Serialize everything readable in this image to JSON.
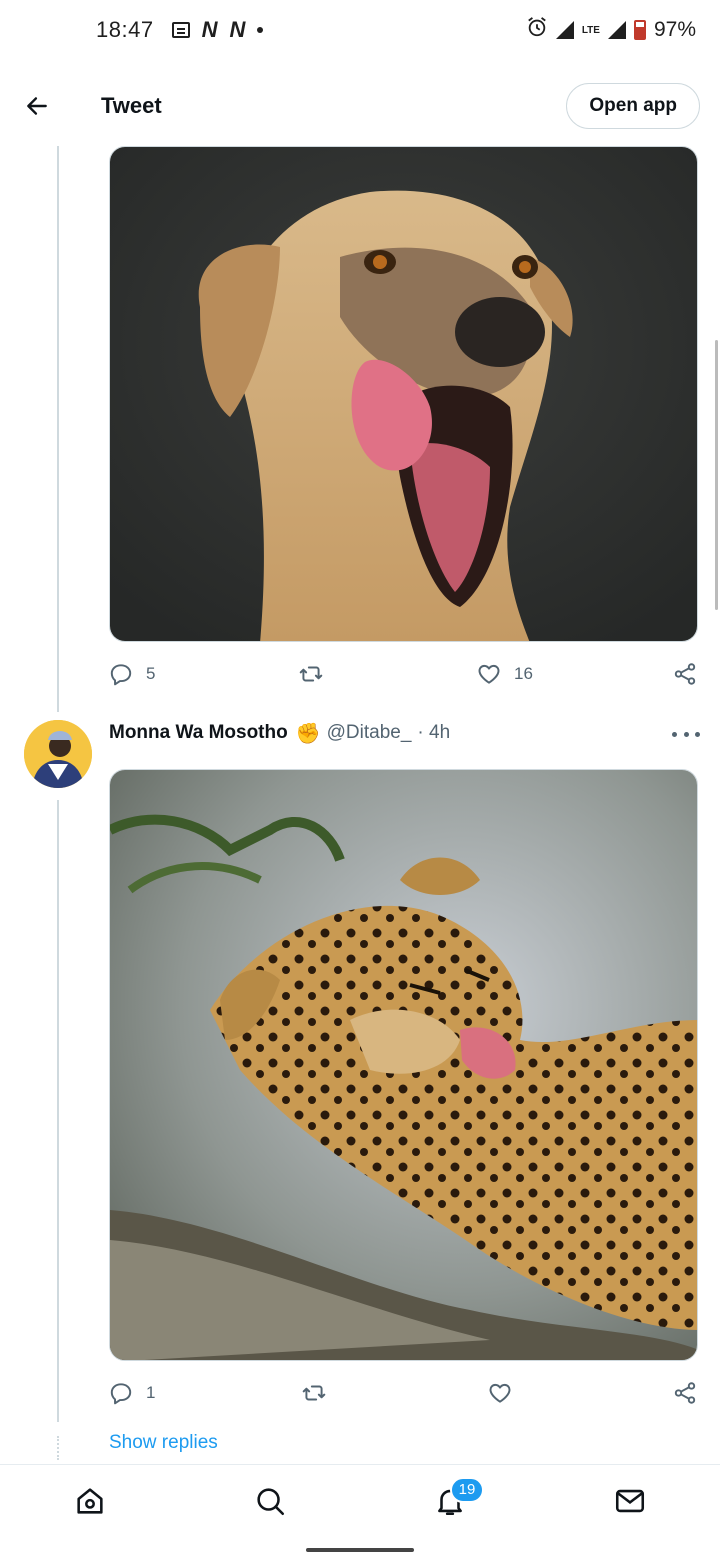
{
  "status_bar": {
    "time": "18:47",
    "battery": "97%",
    "network": "LTE"
  },
  "header": {
    "title": "Tweet",
    "open_app": "Open app"
  },
  "tweet1": {
    "image_desc": "dog-licking-photo",
    "replies": "5",
    "likes": "16"
  },
  "tweet2": {
    "name": "Monna Wa Mosotho",
    "emoji": "✊",
    "handle": "@Ditabe_",
    "time": "· 4h",
    "image_desc": "leopard-licking-photo",
    "replies": "1",
    "likes": ""
  },
  "show_replies": "Show replies",
  "nav": {
    "notifications_badge": "19"
  },
  "colors": {
    "accent": "#1d9bf0",
    "muted": "#536471",
    "border": "#cfd9de"
  }
}
